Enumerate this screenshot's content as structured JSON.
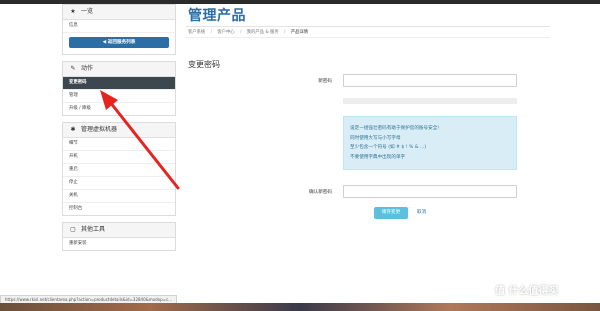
{
  "sidebar": {
    "overview": {
      "title": "一览",
      "icon": "star-icon",
      "info": "信息",
      "back_button": "返回服务列表",
      "back_icon": "arrow-left-icon"
    },
    "actions": {
      "title": "动作",
      "icon": "wrench-icon",
      "items": [
        "变更密码",
        "管理",
        "升级 / 降级"
      ]
    },
    "vm": {
      "title": "管理虚拟机器",
      "icon": "gear-icon",
      "items": [
        "细节",
        "开机",
        "重启",
        "停止",
        "关机",
        "控制台"
      ]
    },
    "other": {
      "title": "其他工具",
      "icon": "square-icon",
      "items": [
        "重新安装"
      ]
    }
  },
  "main": {
    "page_title": "管理产品",
    "breadcrumb": [
      "客户系统",
      "/",
      "客户中心",
      "/",
      "我的产品 & 服务",
      "/",
      "产品详情"
    ],
    "section_title": "变更密码",
    "new_password_label": "新密码",
    "confirm_password_label": "确认新密码",
    "hint_lines": [
      "设定一组强壮密码有助于保护您的账号安全!",
      "同时使用大写与小写字母",
      "至少包含一个符号 (如 # $ ! % & ...)",
      "不要使用字典中出现的单字"
    ],
    "save_button": "储存变更",
    "cancel_link": "取消"
  },
  "status_bar": {
    "url": "https://www.rkisl.net/clientarea.php?action=productdetails&id=32840&modop=c..."
  },
  "watermark": {
    "text": "值 什么值得买"
  },
  "colors": {
    "accent": "#2a6ea5",
    "active_row": "#3d4750",
    "hint_bg": "#d9edf7",
    "save_button": "#5bc0de",
    "arrow": "#e52420"
  }
}
